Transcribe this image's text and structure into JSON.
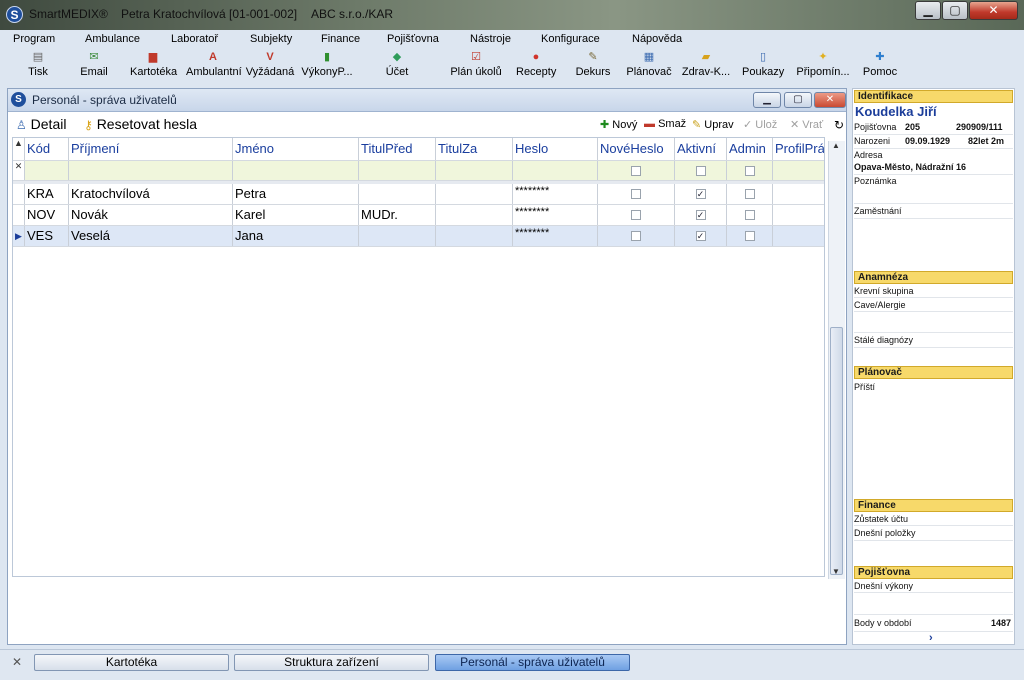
{
  "window": {
    "app_name": "SmartMEDIX®",
    "user": "Petra Kratochvílová [01-001-002]",
    "org": "ABC s.r.o./KAR",
    "minimize": "▁",
    "maximize": "▢",
    "close": "✕"
  },
  "menu": [
    "Program",
    "Ambulance",
    "Laboratoř",
    "Subjekty",
    "Finance",
    "Pojišťovna",
    "Nástroje",
    "Konfigurace",
    "Nápověda"
  ],
  "toolbar": [
    {
      "label": "Tisk",
      "icon": "printer-icon"
    },
    {
      "label": "Email",
      "icon": "email-icon"
    },
    {
      "label": "Kartotéka",
      "icon": "cards-icon"
    },
    {
      "label": "Ambulantní",
      "icon": "ambulance-a-icon"
    },
    {
      "label": "Vyžádaná",
      "icon": "request-v-icon"
    },
    {
      "label": "VýkonyP...",
      "icon": "chart-icon"
    },
    {
      "label": "Účet",
      "icon": "account-icon"
    },
    {
      "label": "Plán úkolů",
      "icon": "tasks-icon"
    },
    {
      "label": "Recepty",
      "icon": "pill-icon"
    },
    {
      "label": "Dekurs",
      "icon": "dekurs-icon"
    },
    {
      "label": "Plánovač",
      "icon": "calendar-icon"
    },
    {
      "label": "Zdrav-K...",
      "icon": "folder-icon"
    },
    {
      "label": "Poukazy",
      "icon": "document-icon"
    },
    {
      "label": "Připomín...",
      "icon": "bulb-icon"
    },
    {
      "label": "Pomoc",
      "icon": "help-icon"
    }
  ],
  "child_window": {
    "title": "Personál - správa uživatelů",
    "detail": "Detail",
    "reset": "Resetovat hesla",
    "actions": {
      "new": "Nový",
      "delete": "Smaž",
      "edit": "Uprav",
      "save": "Ulož",
      "back": "Vrať"
    }
  },
  "grid": {
    "columns": [
      "Kód",
      "Příjmení",
      "Jméno",
      "TitulPřed",
      "TitulZa",
      "Heslo",
      "NovéHeslo",
      "Aktivní",
      "Admin",
      "ProfilPrá"
    ],
    "rows": [
      {
        "kod": "KRA",
        "prijmeni": "Kratochvílová",
        "jmeno": "Petra",
        "titul_pred": "",
        "titul_za": "",
        "heslo": "********",
        "nove_heslo": false,
        "aktivni": true,
        "admin": false,
        "selected": false
      },
      {
        "kod": "NOV",
        "prijmeni": "Novák",
        "jmeno": "Karel",
        "titul_pred": "MUDr.",
        "titul_za": "",
        "heslo": "********",
        "nove_heslo": false,
        "aktivni": true,
        "admin": false,
        "selected": false
      },
      {
        "kod": "VES",
        "prijmeni": "Veselá",
        "jmeno": "Jana",
        "titul_pred": "",
        "titul_za": "",
        "heslo": "********",
        "nove_heslo": false,
        "aktivni": true,
        "admin": false,
        "selected": true
      }
    ]
  },
  "side": {
    "identifikace": "Identifikace",
    "name": "Koudelka Jiří",
    "pojistovna_label": "Pojišťovna",
    "pojistovna_code": "205",
    "rc": "290909/111",
    "narozeni_label": "Narozeni",
    "narozeni": "09.09.1929",
    "vek": "82let 2m",
    "adresa_label": "Adresa",
    "adresa": "Opava-Město, Nádražní 16",
    "poznamka_label": "Poznámka",
    "zamestnani_label": "Zaměstnání",
    "anamneza": "Anamnéza",
    "krevni_label": "Krevní skupina",
    "cave_label": "Cave/Alergie",
    "diagnozy_label": "Stálé diagnózy",
    "planovac": "Plánovač",
    "pristi_label": "Příští",
    "finance": "Finance",
    "zustatek_label": "Zůstatek účtu",
    "polozky_label": "Dnešní položky",
    "pojistovna_sec": "Pojišťovna",
    "vykony_label": "Dnešní výkony",
    "body_label": "Body v období",
    "body": "1487",
    "more": "›"
  },
  "taskbar": {
    "close": "✕",
    "tabs": [
      "Kartotéka",
      "Struktura zařízení",
      "Personál - správa uživatelů"
    ],
    "active": 2
  }
}
